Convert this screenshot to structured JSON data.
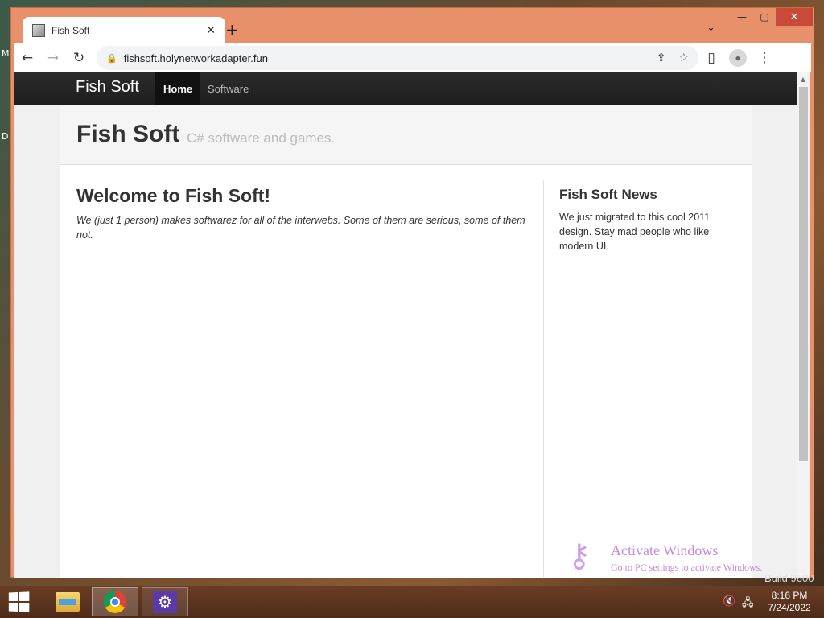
{
  "browser": {
    "tab_title": "Fish Soft",
    "url": "fishsoft.holynetworkadapter.fun"
  },
  "site": {
    "brand": "Fish Soft",
    "nav": [
      "Home",
      "Software"
    ],
    "hero_title": "Fish Soft",
    "hero_subtitle": "C# software and games.",
    "welcome_heading": "Welcome to Fish Soft!",
    "welcome_text": "We (just 1 person) makes softwarez for all of the interwebs. Some of them are serious, some of them not.",
    "news_heading": "Fish Soft News",
    "news_text": "We just migrated to this cool 2011 design. Stay mad people who like modern UI."
  },
  "watermark": {
    "line1": "Activate Windows",
    "line2": "Go to PC settings to activate Windows.",
    "build": "Build 9600"
  },
  "taskbar": {
    "time": "8:16 PM",
    "date": "7/24/2022"
  },
  "desktop": {
    "edge_glyphs": [
      "M",
      "D"
    ]
  },
  "icons": {
    "tab_close": "✕",
    "new_tab": "+",
    "tab_search": "⌄",
    "back": "←",
    "forward": "→",
    "reload": "↻",
    "lock": "🔒",
    "share": "⇪",
    "bookmark": "☆",
    "sidepanel": "▯",
    "menu": "⋮",
    "minimize": "—",
    "maximize": "▢",
    "close": "✕",
    "volume": "🔇",
    "network": "🖧",
    "settings": "⚙",
    "key": "⚷"
  },
  "colors": {
    "window_frame": "#e8906a",
    "navbar": "#222222",
    "win_close": "#c94a38",
    "watermark": "#c38ae0"
  }
}
